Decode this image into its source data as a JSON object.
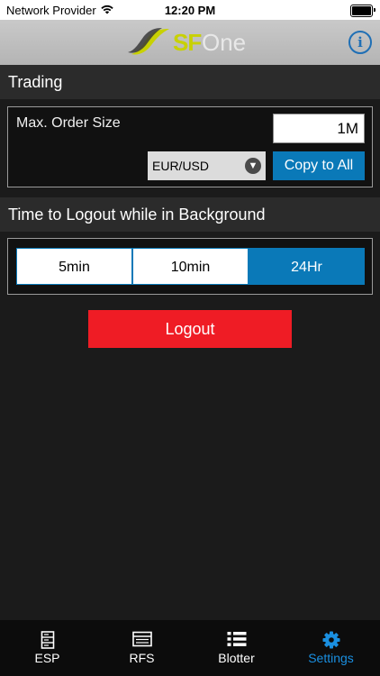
{
  "status_bar": {
    "carrier": "Network Provider",
    "time": "12:20 PM"
  },
  "header": {
    "logo_sf": "SF",
    "logo_one": "One",
    "info_icon": "info-icon",
    "info_glyph": "i"
  },
  "trading": {
    "title": "Trading",
    "max_order_label": "Max. Order Size",
    "max_order_value": "1M",
    "currency_pair": "EUR/USD",
    "copy_button": "Copy to All"
  },
  "logout_timer": {
    "title": "Time to Logout while in Background",
    "options": [
      "5min",
      "10min",
      "24Hr"
    ],
    "selected": "24Hr"
  },
  "logout_button": "Logout",
  "tab_bar": {
    "items": [
      {
        "label": "ESP",
        "icon": "server-icon"
      },
      {
        "label": "RFS",
        "icon": "list-box-icon"
      },
      {
        "label": "Blotter",
        "icon": "bullet-list-icon"
      },
      {
        "label": "Settings",
        "icon": "gear-icon"
      }
    ],
    "active": "Settings"
  },
  "colors": {
    "accent_blue": "#0a79b8",
    "logout_red": "#ef1c25",
    "tab_active": "#1a8fe0",
    "logo_yellow": "#c8d100"
  }
}
